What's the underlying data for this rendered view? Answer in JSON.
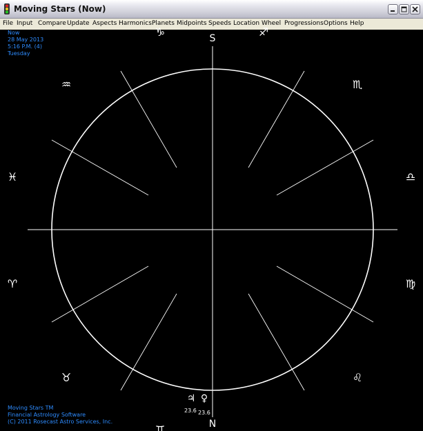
{
  "window": {
    "title": "Moving Stars (Now)",
    "title_icon": "traffic-light-icon",
    "controls": [
      "minimize-icon",
      "maximize-icon",
      "close-icon"
    ]
  },
  "menu": [
    "File",
    "Input",
    "Compare",
    "Update",
    "Aspects",
    "Harmonics",
    "Planets",
    "Midpoints",
    "Speeds",
    "Location",
    "Wheel",
    "Progressions",
    "Options",
    "Help"
  ],
  "chart_info": {
    "label": "Now",
    "date": "28 May 2013",
    "time": "5:16 P.M. (4)",
    "weekday": "Tuesday"
  },
  "compass": {
    "south": "S",
    "north": "N"
  },
  "zodiac": {
    "capricorn": "♑",
    "sagittarius": "♐",
    "aquarius": "♒",
    "scorpio": "♏",
    "pisces": "♓",
    "libra": "♎",
    "aries": "♈",
    "virgo": "♍",
    "taurus": "♉",
    "leo": "♌",
    "gemini": "♊",
    "cancer": "♋"
  },
  "planets": [
    {
      "glyph": "♃",
      "name": "jupiter",
      "degree": "23.6"
    },
    {
      "glyph": "♀",
      "name": "venus",
      "degree": "23.6"
    }
  ],
  "footer": {
    "line1": "Moving Stars TM",
    "line2": "Financial Astrology Software",
    "line3": "(C) 2011 Rosecast Astro Services, Inc."
  },
  "colors": {
    "background": "#000000",
    "lines": "#ffffff",
    "info_text": "#2e8cff",
    "menubar": "#ece9d8"
  }
}
